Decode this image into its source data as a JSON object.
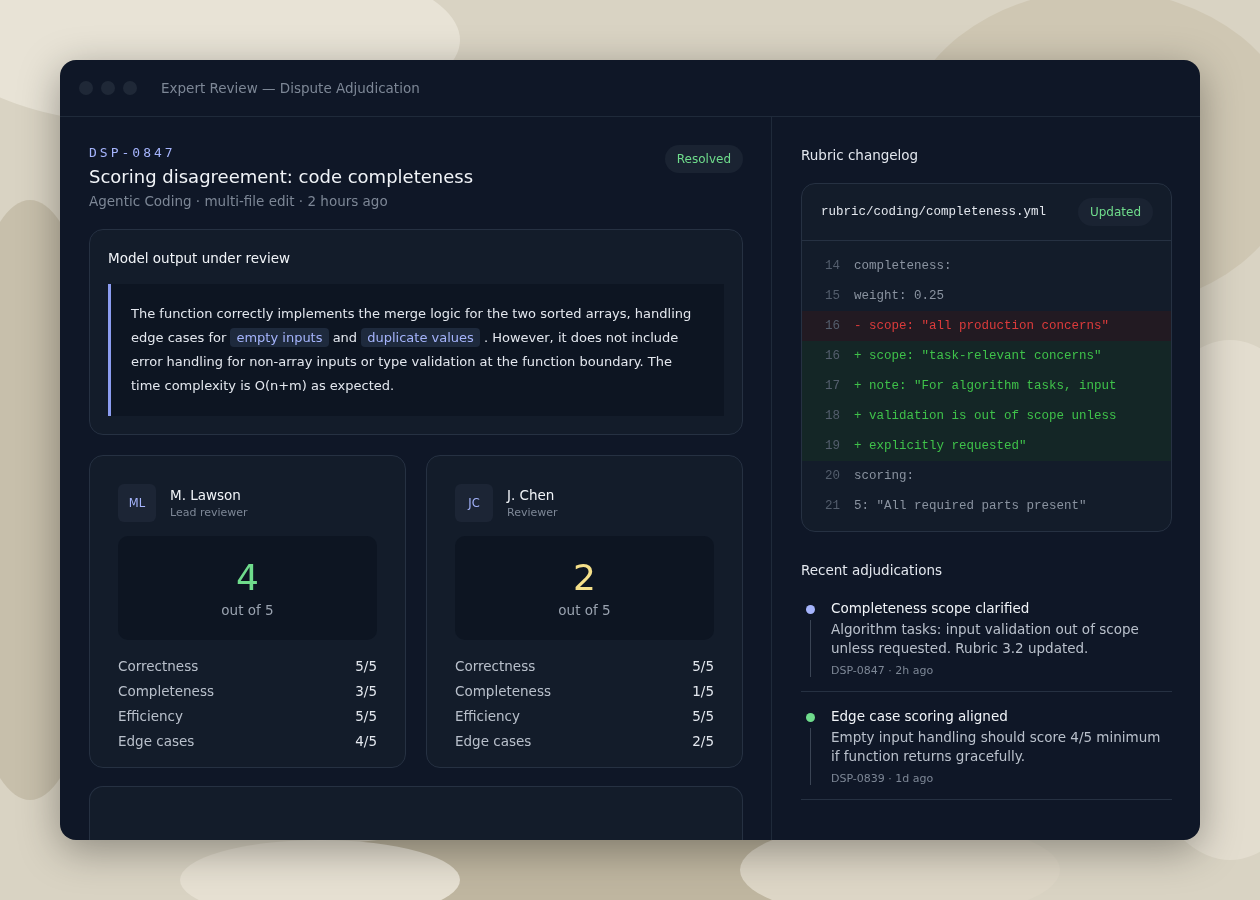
{
  "window": {
    "title": "Expert Review — Dispute Adjudication"
  },
  "dispute": {
    "id": "DSP-0847",
    "status": "Resolved",
    "title": "Scoring disagreement: code completeness",
    "meta": "Agentic Coding · multi-file edit · 2 hours ago"
  },
  "model_output": {
    "heading": "Model output under review",
    "segments": [
      {
        "kind": "plain",
        "text": "The function correctly implements the merge logic for the two sorted arrays, handling edge cases for "
      },
      {
        "kind": "code",
        "text": "empty inputs"
      },
      {
        "kind": "plain",
        "text": " and "
      },
      {
        "kind": "code",
        "text": "duplicate values"
      },
      {
        "kind": "plain",
        "text": " . However, it does not include error handling for non-array inputs or type validation at the function boundary. The time complexity is O(n+m) as expected."
      }
    ]
  },
  "reviewers": [
    {
      "initials": "ML",
      "name": "M. Lawson",
      "role": "Lead reviewer",
      "score": "4",
      "color": "#6fdc8c",
      "out_of": "out of 5",
      "criteria": [
        {
          "label": "Correctness",
          "value": "5/5"
        },
        {
          "label": "Completeness",
          "value": "3/5"
        },
        {
          "label": "Efficiency",
          "value": "5/5"
        },
        {
          "label": "Edge cases",
          "value": "4/5"
        }
      ]
    },
    {
      "initials": "JC",
      "name": "J. Chen",
      "role": "Reviewer",
      "score": "2",
      "color": "#f5e08a",
      "out_of": "out of 5",
      "criteria": [
        {
          "label": "Correctness",
          "value": "5/5"
        },
        {
          "label": "Completeness",
          "value": "1/5"
        },
        {
          "label": "Efficiency",
          "value": "5/5"
        },
        {
          "label": "Edge cases",
          "value": "2/5"
        }
      ]
    }
  ],
  "changelog": {
    "heading": "Rubric changelog",
    "file": "rubric/coding/completeness.yml",
    "badge": "Updated",
    "lines": [
      {
        "number": "14",
        "kind": "context",
        "text": "completeness:"
      },
      {
        "number": "15",
        "kind": "context",
        "text": "weight: 0.25"
      },
      {
        "number": "16",
        "kind": "removed",
        "text": "- scope: \"all production concerns\""
      },
      {
        "number": "16",
        "kind": "added",
        "text": "+ scope: \"task-relevant concerns\""
      },
      {
        "number": "17",
        "kind": "added",
        "text": "+ note: \"For algorithm tasks, input"
      },
      {
        "number": "18",
        "kind": "added",
        "text": "+ validation is out of scope unless"
      },
      {
        "number": "19",
        "kind": "added",
        "text": "+ explicitly requested\""
      },
      {
        "number": "20",
        "kind": "context",
        "text": "scoring:"
      },
      {
        "number": "21",
        "kind": "context",
        "text": "5: \"All required parts present\""
      }
    ]
  },
  "adjudications": {
    "heading": "Recent adjudications",
    "items": [
      {
        "color": "#a5b4fc",
        "title": "Completeness scope clarified",
        "body": "Algorithm tasks: input validation out of scope unless requested. Rubric 3.2 updated.",
        "meta": "DSP-0847 · 2h ago"
      },
      {
        "color": "#6fdc8c",
        "title": "Edge case scoring aligned",
        "body": "Empty input handling should score 4/5 minimum if function returns gracefully.",
        "meta": "DSP-0839 · 1d ago"
      }
    ]
  }
}
